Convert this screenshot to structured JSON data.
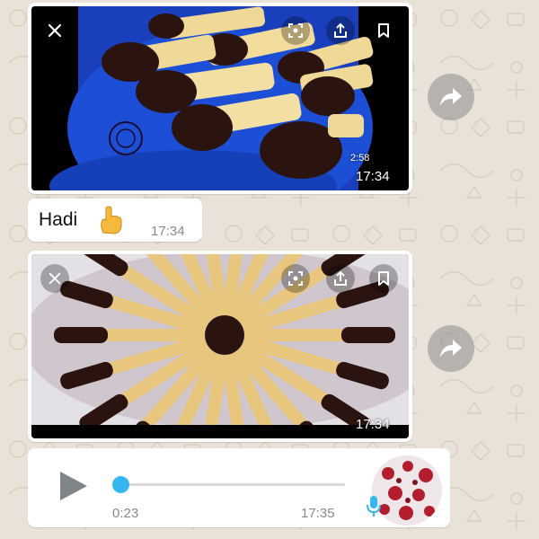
{
  "colors": {
    "wallpaper": "#e8e2d8",
    "bubble": "#ffffff",
    "timestamp": "#8a8a8a",
    "playhead": "#34b7f1",
    "mic": "#34b7f1",
    "play_icon": "#7f8487",
    "chocolate": "#2b1410",
    "biscuit": "#f0d896",
    "plate": "#1c4fd6"
  },
  "messages": [
    {
      "type": "video",
      "duration": "2:58",
      "time": "17:34",
      "icons": [
        "close-icon",
        "screen-scan-icon",
        "share-icon",
        "bookmark-icon"
      ]
    },
    {
      "type": "text",
      "text": "Hadi",
      "emoji": "pointing-hand-emoji",
      "time": "17:34"
    },
    {
      "type": "video",
      "time": "17:34",
      "icons": [
        "close-icon",
        "screen-scan-icon",
        "share-icon",
        "bookmark-icon"
      ]
    },
    {
      "type": "voice",
      "elapsed": "0:23",
      "time": "17:35",
      "progress": 0.0,
      "icons": [
        "play-icon",
        "microphone-icon",
        "sender-avatar"
      ]
    }
  ]
}
